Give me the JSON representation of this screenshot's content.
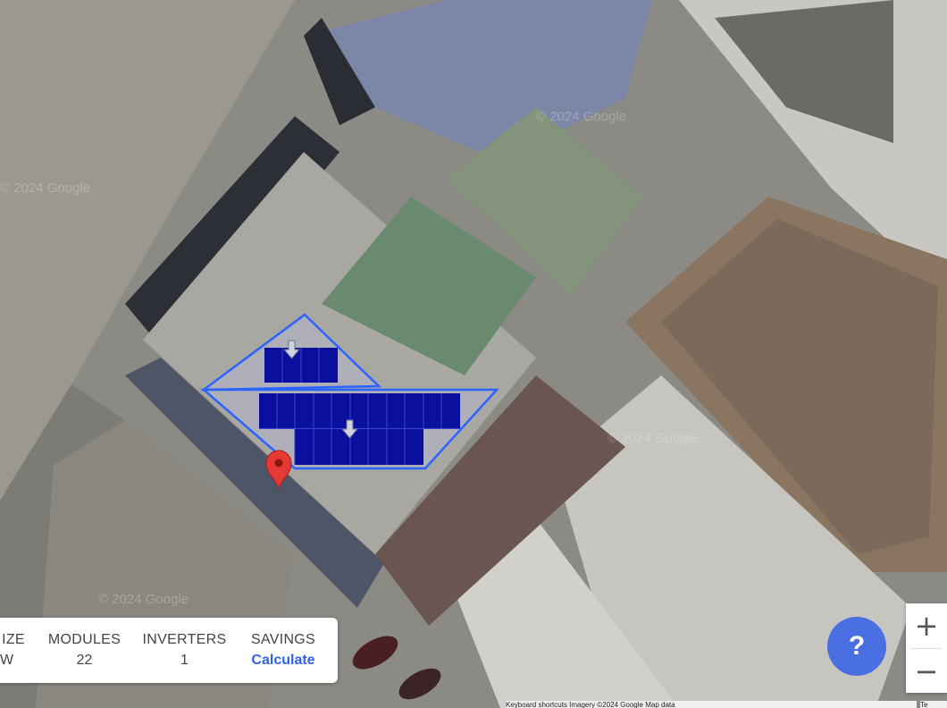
{
  "map": {
    "watermark": "© 2024 Google",
    "colors": {
      "panel": "#0a0f9e",
      "panel_grid": "#3a46d6",
      "outline": "#2b63ff",
      "pin": "#e53935"
    }
  },
  "stats": [
    {
      "label": "IZE",
      "value": "W"
    },
    {
      "label": "MODULES",
      "value": "22"
    },
    {
      "label": "INVERTERS",
      "value": "1"
    },
    {
      "label": "SAVINGS",
      "value": "Calculate"
    }
  ],
  "zoom": {
    "in_label": "+",
    "out_label": "−"
  },
  "help": {
    "label": "?"
  },
  "attribution": {
    "text": "Keyboard shortcuts   Imagery ©2024 Google   Map data",
    "terms": "Te"
  }
}
